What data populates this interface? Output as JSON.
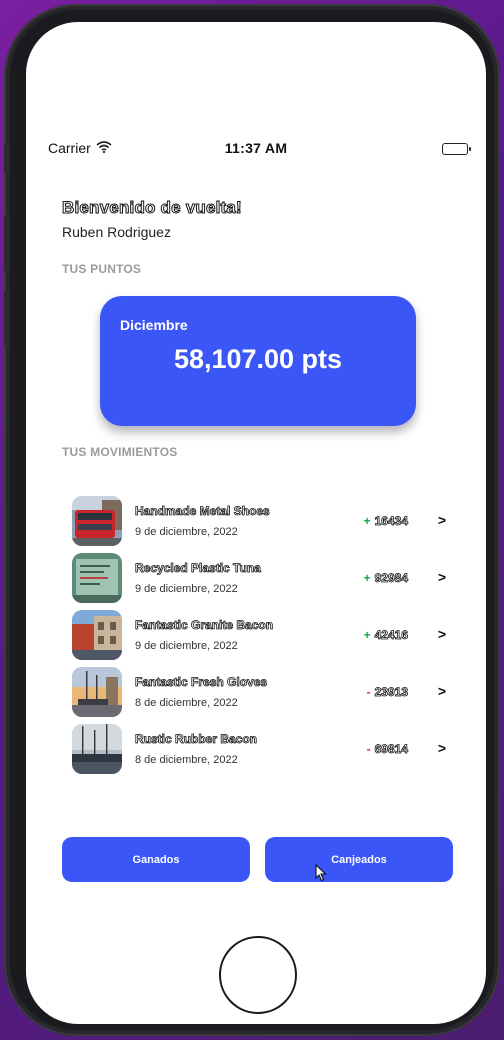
{
  "status_bar": {
    "carrier": "Carrier",
    "time": "11:37 AM"
  },
  "header": {
    "welcome": "Bienvenido de vuelta!",
    "user_name": "Ruben Rodriguez"
  },
  "points": {
    "section_label": "TUS PUNTOS",
    "month": "Diciembre",
    "value": "58,107.00 pts",
    "card_color": "#3a56f6"
  },
  "movements": {
    "section_label": "TUS MOVIMIENTOS",
    "items": [
      {
        "name": "Handmade Metal Shoes",
        "date": "9 de diciembre, 2022",
        "sign": "+",
        "amount": "16434",
        "thumb": "red-bus-photo"
      },
      {
        "name": "Recycled Plastic Tuna",
        "date": "9 de diciembre, 2022",
        "sign": "+",
        "amount": "92984",
        "thumb": "sign-photo"
      },
      {
        "name": "Fantastic Granite Bacon",
        "date": "9 de diciembre, 2022",
        "sign": "+",
        "amount": "42416",
        "thumb": "harbor-building-photo"
      },
      {
        "name": "Fantastic Fresh Gloves",
        "date": "8 de diciembre, 2022",
        "sign": "-",
        "amount": "23913",
        "thumb": "boats-sunset-photo"
      },
      {
        "name": "Rustic Rubber Bacon",
        "date": "8 de diciembre, 2022",
        "sign": "-",
        "amount": "69814",
        "thumb": "marina-photo"
      }
    ]
  },
  "buttons": {
    "earned": "Ganados",
    "redeemed": "Canjeados"
  },
  "colors": {
    "accent": "#3a56f6",
    "positive": "#1aa34a",
    "negative": "#e0322a"
  }
}
